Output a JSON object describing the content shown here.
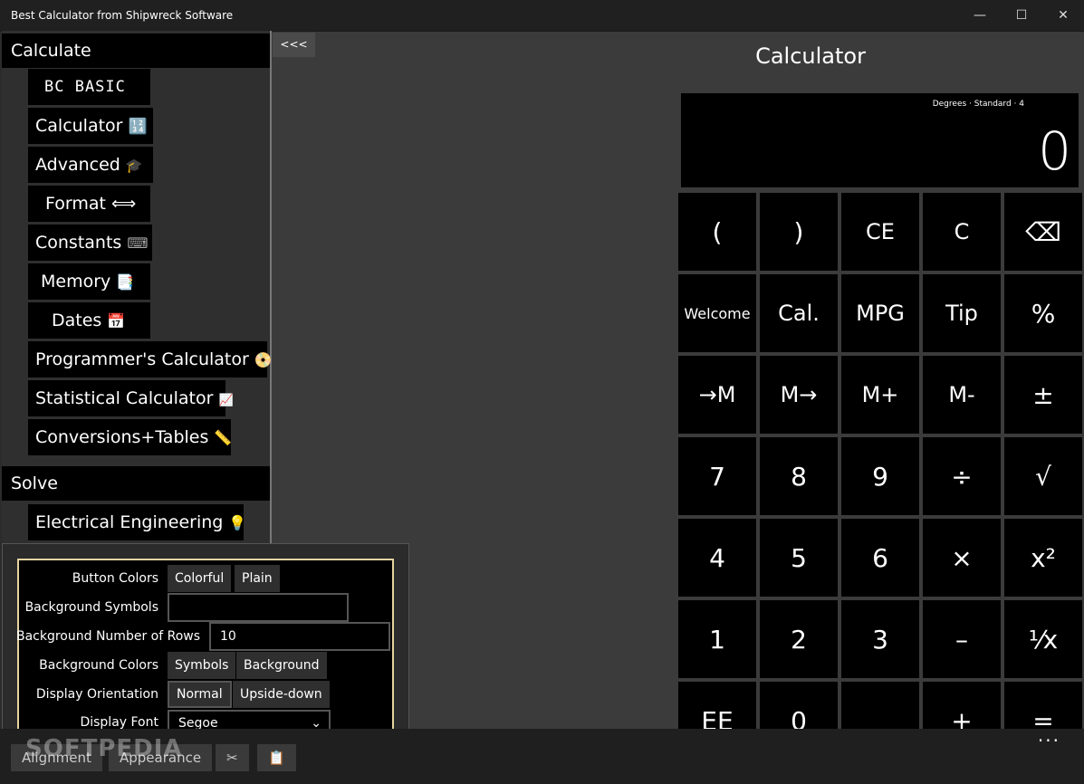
{
  "window": {
    "title": "Best Calculator from Shipwreck Software",
    "minimize": "—",
    "maximize": "☐",
    "close": "✕"
  },
  "sidebar": {
    "calculate_header": "Calculate",
    "items": [
      {
        "label": "BC BASIC",
        "icon": ""
      },
      {
        "label": "Calculator",
        "icon": "🔢"
      },
      {
        "label": "Advanced",
        "icon": "🎓"
      },
      {
        "label": "Format",
        "icon": "⟺"
      },
      {
        "label": "Constants",
        "icon": "⌨"
      },
      {
        "label": "Memory",
        "icon": "📑"
      },
      {
        "label": "Dates",
        "icon": "📅"
      },
      {
        "label": "Programmer's Calculator",
        "icon": "📀"
      },
      {
        "label": "Statistical Calculator",
        "icon": "📈"
      },
      {
        "label": "Conversions+Tables",
        "icon": "📏"
      }
    ],
    "solve_header": "Solve",
    "solve_items": [
      {
        "label": "Electrical Engineering",
        "icon": "💡"
      }
    ]
  },
  "collapse_label": "<<<",
  "calculator": {
    "title": "Calculator",
    "status": "Degrees · Standard · 4",
    "display_value": "0",
    "keys": [
      [
        "(",
        ")",
        "CE",
        "C",
        "⌫"
      ],
      [
        "Welcome",
        "Cal.",
        "MPG",
        "Tip",
        "%"
      ],
      [
        "→M",
        "M→",
        "M+",
        "M-",
        "±"
      ],
      [
        "7",
        "8",
        "9",
        "÷",
        "√"
      ],
      [
        "4",
        "5",
        "6",
        "×",
        "x²"
      ],
      [
        "1",
        "2",
        "3",
        "–",
        "⅟x"
      ],
      [
        "EE",
        "0",
        "",
        "+",
        "="
      ]
    ]
  },
  "appearance_popup": {
    "button_colors_label": "Button Colors",
    "button_colors_options": [
      "Colorful",
      "Plain"
    ],
    "background_symbols_label": "Background Symbols",
    "background_symbols_value": "",
    "background_rows_label": "Background Number of Rows",
    "background_rows_value": "10",
    "background_colors_label": "Background Colors",
    "background_colors_options": [
      "Symbols",
      "Background"
    ],
    "display_orientation_label": "Display Orientation",
    "display_orientation_options": [
      "Normal",
      "Upside-down"
    ],
    "display_font_label": "Display Font",
    "display_font_value": "Segoe"
  },
  "bottom_bar": {
    "alignment": "Alignment",
    "appearance": "Appearance",
    "cut_icon": "✂",
    "paste_icon": "📋",
    "more": "···"
  },
  "watermark": "SOFTPEDIA"
}
